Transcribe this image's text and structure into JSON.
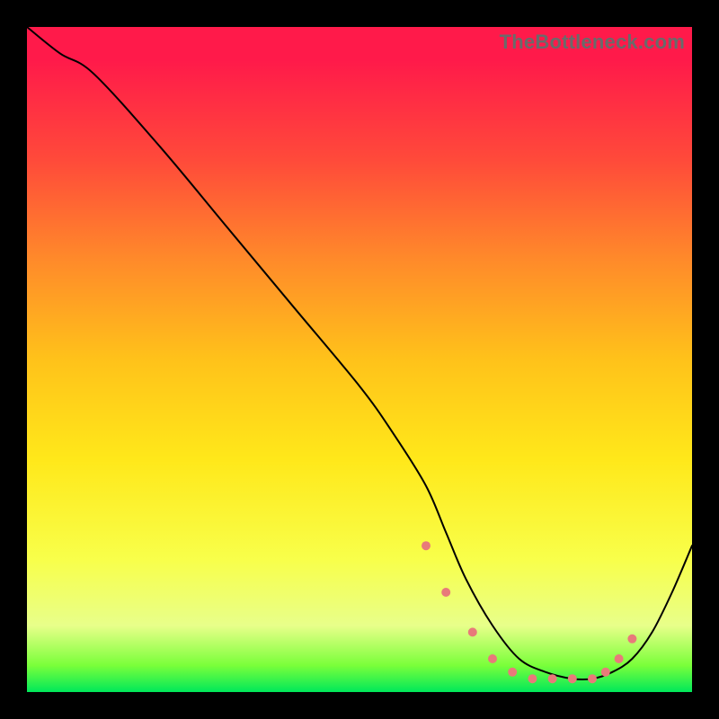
{
  "watermark": "TheBottleneck.com",
  "chart_data": {
    "type": "line",
    "title": "",
    "xlabel": "",
    "ylabel": "",
    "xlim": [
      0,
      100
    ],
    "ylim": [
      0,
      100
    ],
    "grid": false,
    "legend": false,
    "background": "heatmap-gradient",
    "gradient_stops": [
      {
        "pos": 0.0,
        "color": "#ff1a4a"
      },
      {
        "pos": 0.2,
        "color": "#ff4a3a"
      },
      {
        "pos": 0.5,
        "color": "#ffe81a"
      },
      {
        "pos": 0.9,
        "color": "#e8ff8a"
      },
      {
        "pos": 1.0,
        "color": "#00e85a"
      }
    ],
    "series": [
      {
        "name": "bottleneck-curve",
        "x": [
          0,
          5,
          10,
          20,
          30,
          40,
          50,
          55,
          60,
          63,
          66,
          70,
          74,
          78,
          82,
          85,
          88,
          91,
          94,
          97,
          100
        ],
        "y": [
          100,
          96,
          93,
          82,
          70,
          58,
          46,
          39,
          31,
          24,
          17,
          10,
          5,
          3,
          2,
          2,
          3,
          5,
          9,
          15,
          22
        ]
      }
    ],
    "markers": {
      "name": "highlight-dots",
      "color": "#e87a7a",
      "x": [
        60,
        63,
        67,
        70,
        73,
        76,
        79,
        82,
        85,
        87,
        89,
        91
      ],
      "y": [
        22,
        15,
        9,
        5,
        3,
        2,
        2,
        2,
        2,
        3,
        5,
        8
      ]
    }
  }
}
